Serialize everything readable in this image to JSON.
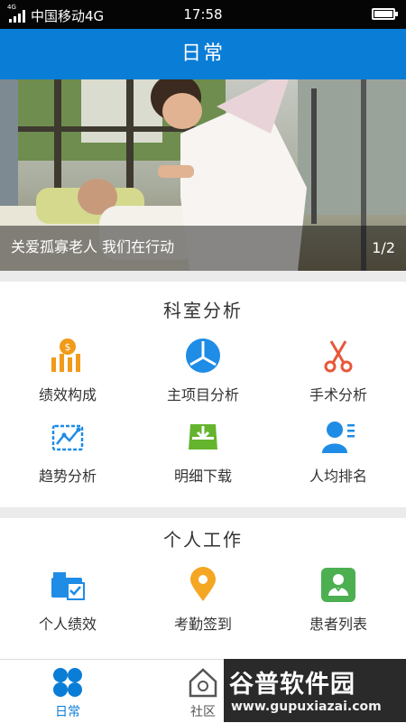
{
  "status_bar": {
    "network_type": "4G",
    "carrier": "中国移动4G",
    "time": "17:58",
    "icons": [
      "signal-icon",
      "battery-icon"
    ]
  },
  "header": {
    "title": "日常"
  },
  "banner": {
    "caption": "关爱孤寡老人 我们在行动",
    "pager": "1/2",
    "image_name": "photo-nurse-with-elderly-patient"
  },
  "sections": [
    {
      "title": "科室分析",
      "items": [
        {
          "label": "绩效构成",
          "icon": "performance-chart-icon",
          "color": "#f29a1a"
        },
        {
          "label": "主项目分析",
          "icon": "pie-chart-icon",
          "color": "#1f8ce6"
        },
        {
          "label": "手术分析",
          "icon": "scissors-icon",
          "color": "#e8573a"
        },
        {
          "label": "趋势分析",
          "icon": "trend-line-icon",
          "color": "#1f8ce6"
        },
        {
          "label": "明细下载",
          "icon": "download-tray-icon",
          "color": "#64b42e"
        },
        {
          "label": "人均排名",
          "icon": "user-ranking-icon",
          "color": "#1f8ce6"
        }
      ]
    },
    {
      "title": "个人工作",
      "items": [
        {
          "label": "个人绩效",
          "icon": "personal-performance-icon",
          "color": "#1f8ce6"
        },
        {
          "label": "考勤签到",
          "icon": "location-pin-icon",
          "color": "#f5a623"
        },
        {
          "label": "患者列表",
          "icon": "patient-list-icon",
          "color": "#4caf50"
        }
      ]
    }
  ],
  "tabbar": {
    "tabs": [
      {
        "label": "日常",
        "icon": "grid-icon",
        "active": true
      },
      {
        "label": "社区",
        "icon": "house-icon",
        "active": false
      }
    ],
    "active_color": "#0a7dd6"
  },
  "watermark": {
    "brand": "谷普软件园",
    "url": "www.gupuxiazai.com"
  }
}
